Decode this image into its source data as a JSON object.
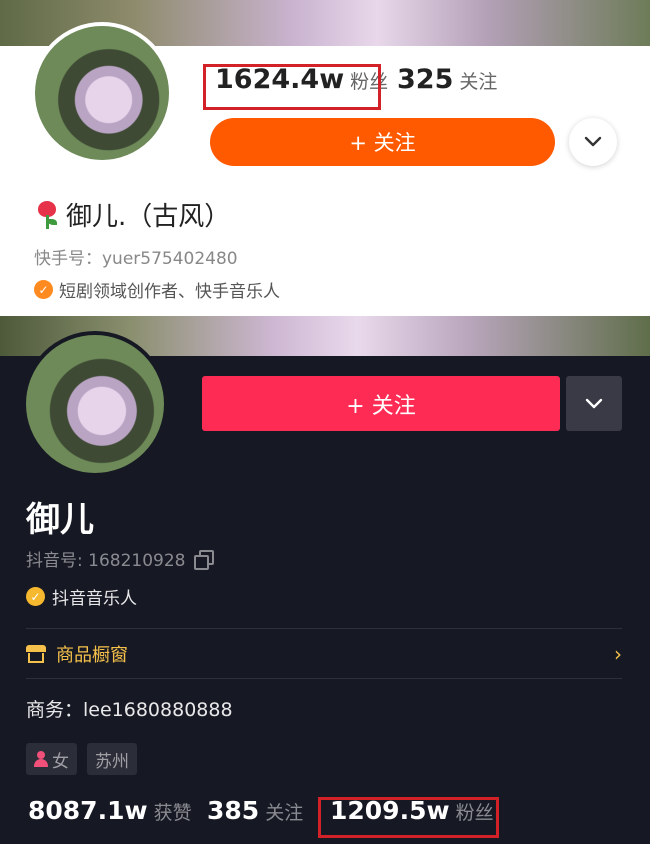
{
  "kuaishou": {
    "fans_value": "1624.4w",
    "fans_label": "粉丝",
    "following_value": "325",
    "following_label": "关注",
    "follow_button": "+ 关注",
    "name": "御儿.（古风）",
    "id_text": "快手号：yuer575402480",
    "cert_text": "短剧领域创作者、快手音乐人",
    "icons": {
      "name_emoji": "tulip-icon",
      "more": "chevron-down-icon",
      "cert": "check-badge-icon"
    },
    "colors": {
      "follow": "#ff5a00",
      "highlight": "#d32227",
      "cert": "#ff8a1f"
    }
  },
  "douyin": {
    "follow_button": "+ 关注",
    "name": "御儿",
    "id_text": "抖音号: 168210928",
    "cert_text": "抖音音乐人",
    "shop_label": "商品橱窗",
    "business": "商务：lee1680880888",
    "tags": {
      "gender": "女",
      "city": "苏州"
    },
    "likes_value": "8087.1w",
    "likes_label": "获赞",
    "following_value": "385",
    "following_label": "关注",
    "fans_value": "1209.5w",
    "fans_label": "粉丝",
    "icons": {
      "more": "chevron-down-icon",
      "copy": "copy-icon",
      "cert": "check-badge-icon",
      "shop": "shop-icon",
      "gender": "female-icon"
    },
    "colors": {
      "background": "#161823",
      "follow": "#fe2c55",
      "shop": "#f5c14a",
      "highlight": "#d32227"
    }
  }
}
